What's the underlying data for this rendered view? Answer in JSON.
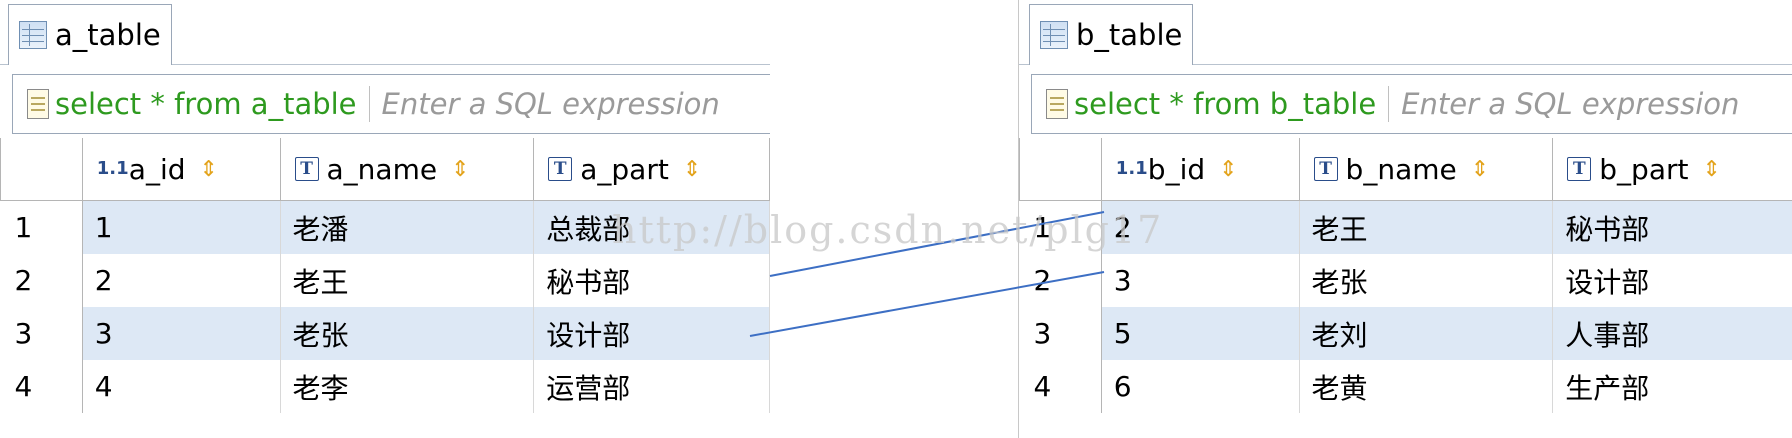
{
  "left_panel": {
    "tab_label": "a_table",
    "sql": "select * from a_table",
    "sql_placeholder": "Enter a SQL expression",
    "columns": [
      "a_id",
      "a_name",
      "a_part"
    ],
    "row_numbers": [
      "1",
      "2",
      "3",
      "4"
    ],
    "rows": [
      [
        "1",
        "老潘",
        "总裁部"
      ],
      [
        "2",
        "老王",
        "秘书部"
      ],
      [
        "3",
        "老张",
        "设计部"
      ],
      [
        "4",
        "老李",
        "运营部"
      ]
    ]
  },
  "right_panel": {
    "tab_label": "b_table",
    "sql": "select * from b_table",
    "sql_placeholder": "Enter a SQL expression",
    "columns": [
      "b_id",
      "b_name",
      "b_part"
    ],
    "row_numbers": [
      "1",
      "2",
      "3",
      "4"
    ],
    "rows": [
      [
        "2",
        "老王",
        "秘书部"
      ],
      [
        "3",
        "老张",
        "设计部"
      ],
      [
        "5",
        "老刘",
        "人事部"
      ],
      [
        "6",
        "老黄",
        "生产部"
      ]
    ]
  },
  "watermark": "http://blog.csdn.net/plg17",
  "icons": {
    "table": "table-icon",
    "script": "sql-script-icon",
    "numeric_column": "numeric-column-icon",
    "text_column": "text-column-icon",
    "sort": "sort-arrows-icon"
  },
  "colors": {
    "sql_text": "#2e9a1f",
    "row_highlight": "#dde8f5",
    "connector_line": "#3d6fc4",
    "sort_icon": "#e3a31b"
  }
}
